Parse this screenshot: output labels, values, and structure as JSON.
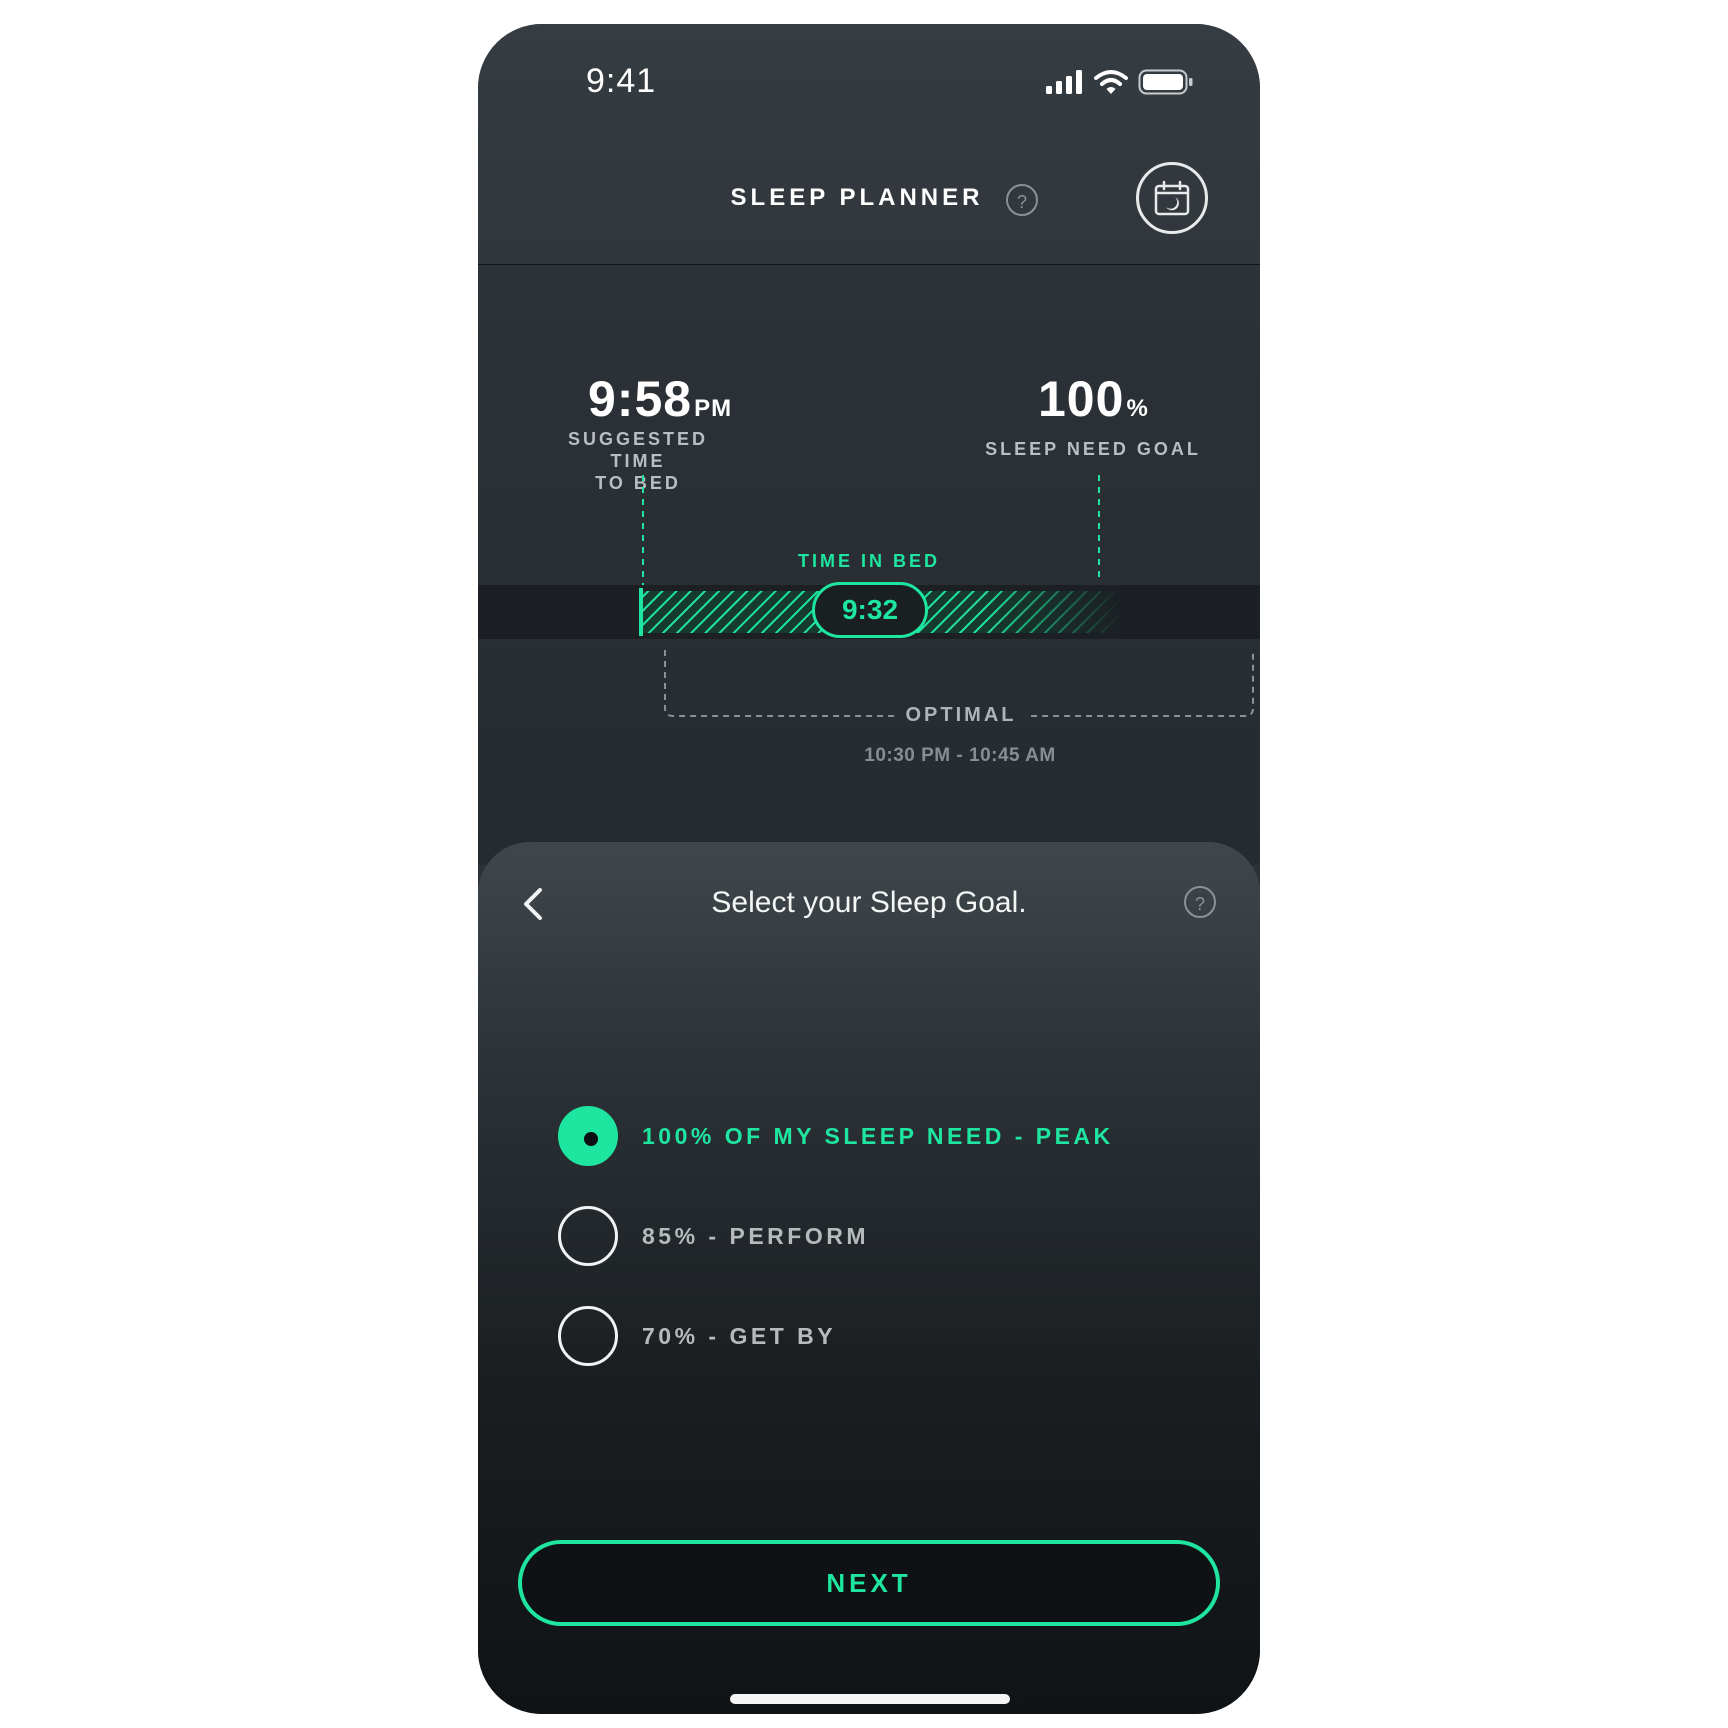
{
  "status_bar": {
    "time": "9:41"
  },
  "header": {
    "title": "SLEEP PLANNER",
    "help_glyph": "?"
  },
  "planner": {
    "bed_time": {
      "value": "9:58",
      "unit": "PM",
      "label_line1": "SUGGESTED TIME",
      "label_line2": "TO BED"
    },
    "sleep_goal": {
      "value": "100",
      "unit": "%",
      "label": "SLEEP NEED GOAL"
    },
    "time_in_bed": {
      "label": "TIME IN BED",
      "value": "9:32"
    },
    "optimal": {
      "label": "OPTIMAL",
      "range": "10:30 PM - 10:45 AM"
    }
  },
  "sheet": {
    "title": "Select your Sleep Goal.",
    "help_glyph": "?",
    "options": [
      {
        "label": "100% OF MY SLEEP NEED - PEAK",
        "selected": true
      },
      {
        "label": "85% - PERFORM",
        "selected": false
      },
      {
        "label": "70% - GET BY",
        "selected": false
      }
    ],
    "next_label": "NEXT"
  },
  "colors": {
    "accent": "#1ee59f",
    "background": "#2c3237",
    "sheet_bottom": "#101315"
  },
  "icons": [
    "signal-icon",
    "wifi-icon",
    "battery-icon",
    "help-icon",
    "calendar-moon-icon",
    "back-chevron-icon"
  ]
}
